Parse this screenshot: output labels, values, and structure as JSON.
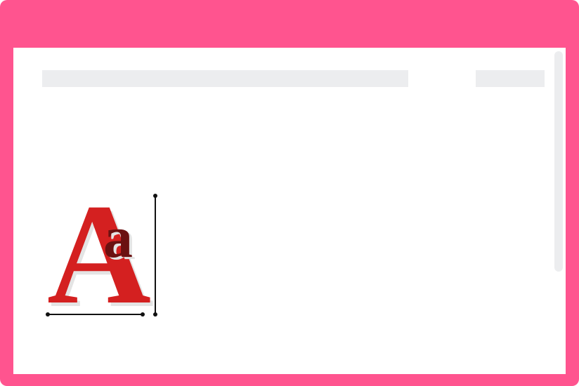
{
  "window": {
    "frame_color": "#FF548F",
    "background_color": "#FFFFFF",
    "placeholder_color": "#ECEDEF"
  },
  "illustration": {
    "icon": "font-size-icon",
    "glyph_large": "A",
    "glyph_small": "a",
    "glyph_large_color": "#D42020",
    "glyph_small_color": "#6B1111",
    "shadow_color": "#E4E4E4",
    "measure_line_color": "#111111"
  }
}
